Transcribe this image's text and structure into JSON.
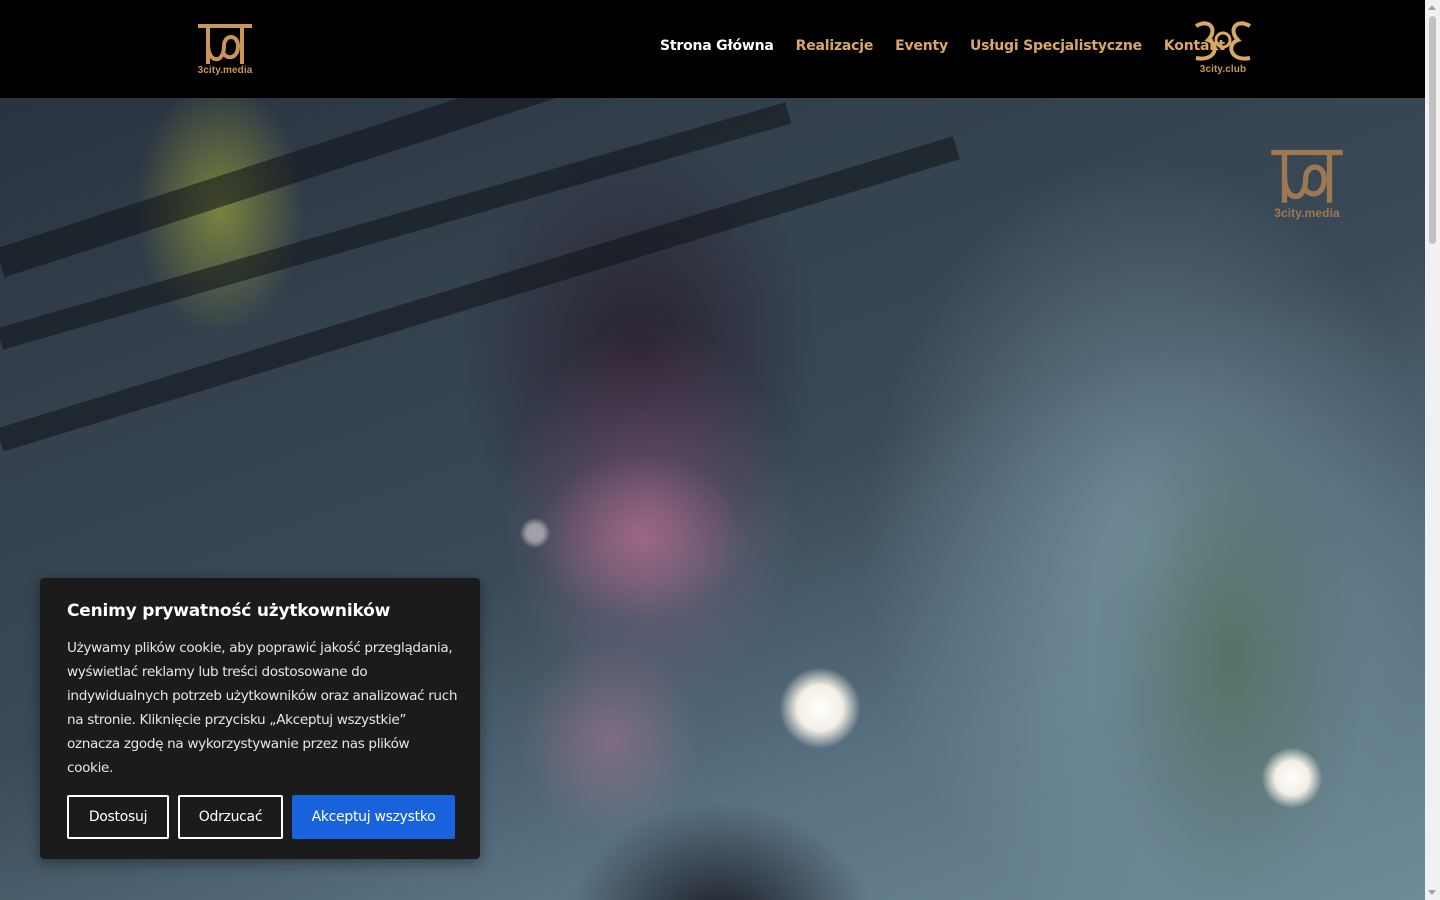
{
  "header": {
    "logo_left_text": "3city.media",
    "logo_right_text": "3city.club",
    "nav": [
      {
        "label": "Strona Główna",
        "active": true
      },
      {
        "label": "Realizacje",
        "active": false
      },
      {
        "label": "Eventy",
        "active": false
      },
      {
        "label": "Usługi Specjalistyczne",
        "active": false
      },
      {
        "label": "Kontakt",
        "active": false
      }
    ]
  },
  "hero": {
    "watermark_text": "3city.media"
  },
  "cookie_banner": {
    "title": "Cenimy prywatność użytkowników",
    "body": "Używamy plików cookie, aby poprawić jakość przeglądania, wyświetlać reklamy lub treści dostosowane do indywidualnych potrzeb użytkowników oraz analizować ruch na stronie. Kliknięcie przycisku „Akceptuj wszystkie” oznacza zgodę na wykorzystywanie przez nas plików cookie.",
    "customize_label": "Dostosuj",
    "reject_label": "Odrzucać",
    "accept_label": "Akceptuj wszystko"
  },
  "colors": {
    "brand_gold": "#c8955c",
    "nav_gold": "#d9a766",
    "accept_blue": "#1863dc",
    "banner_bg": "#1b1b1b"
  }
}
